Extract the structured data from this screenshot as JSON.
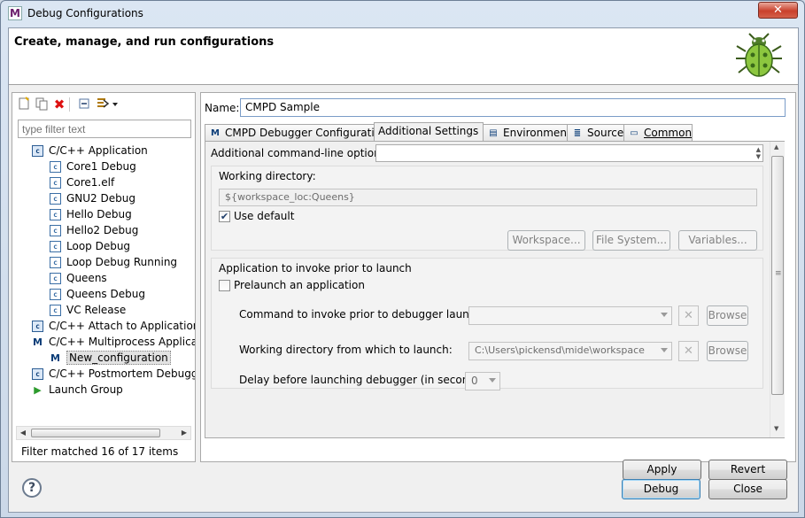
{
  "window": {
    "title": "Debug Configurations",
    "app_icon": "M",
    "close_glyph": "✕"
  },
  "header": {
    "title": "Create, manage, and run configurations",
    "image": "bug-icon"
  },
  "left": {
    "filter_placeholder": "type filter text",
    "tree": [
      {
        "label": "C/C++ Application",
        "icon": "c",
        "level": 0
      },
      {
        "label": "Core1 Debug",
        "icon": "c",
        "level": 1
      },
      {
        "label": "Core1.elf",
        "icon": "c",
        "level": 1
      },
      {
        "label": "GNU2 Debug",
        "icon": "c",
        "level": 1
      },
      {
        "label": "Hello Debug",
        "icon": "c",
        "level": 1
      },
      {
        "label": "Hello2 Debug",
        "icon": "c",
        "level": 1
      },
      {
        "label": "Loop Debug",
        "icon": "c",
        "level": 1
      },
      {
        "label": "Loop Debug Running",
        "icon": "c",
        "level": 1
      },
      {
        "label": "Queens",
        "icon": "c",
        "level": 1
      },
      {
        "label": "Queens Debug",
        "icon": "c",
        "level": 1
      },
      {
        "label": "VC Release",
        "icon": "c",
        "level": 1
      },
      {
        "label": "C/C++ Attach to Application",
        "icon": "c",
        "level": 0
      },
      {
        "label": "C/C++ Multiprocess Applicat",
        "icon": "m",
        "level": 0
      },
      {
        "label": "New_configuration",
        "icon": "m",
        "level": 1,
        "selected": true
      },
      {
        "label": "C/C++ Postmortem Debugg",
        "icon": "c",
        "level": 0
      },
      {
        "label": "Launch Group",
        "icon": "play",
        "level": 0
      }
    ],
    "filter_message": "Filter matched 16 of 17 items"
  },
  "right": {
    "name_label": "Name:",
    "name_value": "CMPD Sample",
    "tabs": [
      {
        "label": "CMPD Debugger Configuration",
        "icon": "mide-icon"
      },
      {
        "label": "Additional Settings",
        "icon": "none",
        "active": true
      },
      {
        "label": "Environment",
        "icon": "environment-icon"
      },
      {
        "label": "Source",
        "icon": "source-icon"
      },
      {
        "label": "Common",
        "icon": "common-icon"
      }
    ],
    "additional_cmd_label": "Additional command-line options:",
    "additional_cmd_value": "",
    "working_dir": {
      "title": "Working directory:",
      "value": "${workspace_loc:Queens}",
      "use_default_label": "Use default",
      "use_default_checked": true,
      "buttons": {
        "workspace": "Workspace...",
        "file_system": "File System...",
        "variables": "Variables..."
      }
    },
    "prelaunch": {
      "title": "Application to invoke prior to launch",
      "checkbox_label": "Prelaunch an application",
      "checked": false,
      "command_label": "Command to invoke prior to debugger launch:",
      "command_value": "",
      "workdir_label": "Working directory from which to launch:",
      "workdir_value": "C:\\Users\\pickensd\\mide\\workspace",
      "delay_label": "Delay before launching debugger (in seconds):",
      "delay_value": "0",
      "browse_label": "Browse"
    },
    "apply_label": "Apply",
    "revert_label": "Revert"
  },
  "footer": {
    "help_glyph": "?",
    "debug_label": "Debug",
    "close_label": "Close"
  }
}
